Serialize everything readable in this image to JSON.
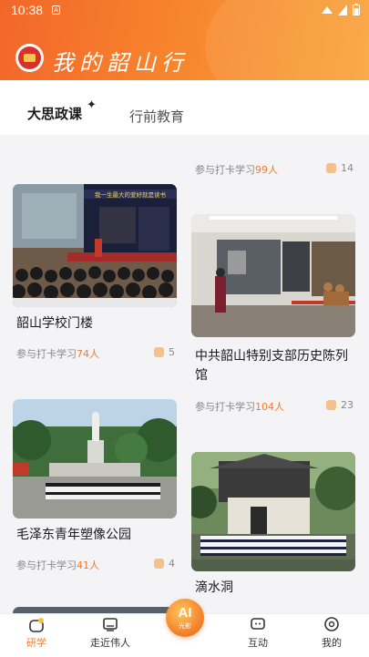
{
  "status": {
    "time": "10:38",
    "app_badge": "A"
  },
  "header": {
    "brand": "我的韶山行"
  },
  "tabs": {
    "active": "大思政课",
    "other": "行前教育"
  },
  "cards": [
    {
      "title": "",
      "meta_prefix": "参与打卡学习",
      "count": "99人",
      "likes": "14"
    },
    {
      "title": "韶山学校门楼",
      "meta_prefix": "参与打卡学习",
      "count": "74人",
      "likes": "5",
      "photo_banner": "我一生最大的爱好就是读书"
    },
    {
      "title": "中共韶山特别支部历史陈列馆",
      "meta_prefix": "参与打卡学习",
      "count": "104人",
      "likes": "23"
    },
    {
      "title": "毛泽东青年塑像公园",
      "meta_prefix": "参与打卡学习",
      "count": "41人",
      "likes": "4"
    },
    {
      "title": "滴水洞",
      "meta_prefix": "",
      "count": "",
      "likes": ""
    }
  ],
  "nav": {
    "items": [
      "研学",
      "走近伟人",
      "互动",
      "我的"
    ],
    "ai_label": "AI",
    "ai_sub": "光影"
  },
  "colors": {
    "accent": "#f07c2c",
    "header_start": "#f2662a",
    "header_end": "#f9a43b"
  }
}
